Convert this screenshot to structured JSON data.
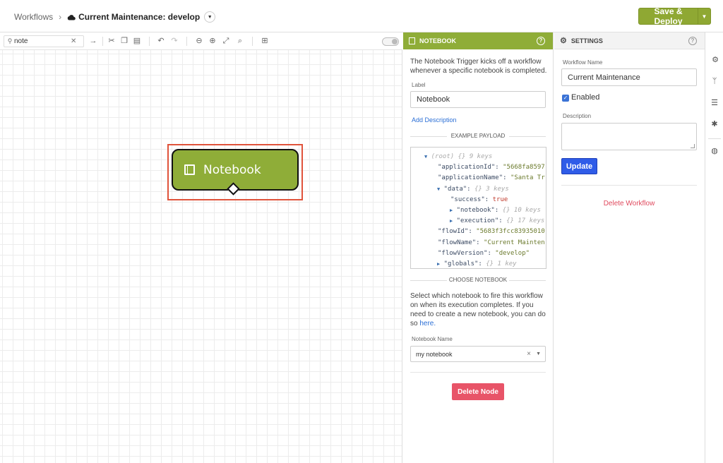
{
  "topbar": {
    "breadcrumb_root": "Workflows",
    "breadcrumb_sep": "›",
    "workflow_title": "Current Maintenance: develop",
    "save_label": "Save & Deploy"
  },
  "toolbar": {
    "search_value": "note",
    "search_placeholder": "Search"
  },
  "canvas": {
    "node_label": "Notebook"
  },
  "node_panel": {
    "title": "NOTEBOOK",
    "description": "The Notebook Trigger kicks off a workflow whenever a specific notebook is completed.",
    "label_caption": "Label",
    "label_value": "Notebook",
    "add_description": "Add Description",
    "example_payload_heading": "EXAMPLE PAYLOAD",
    "payload_lines": [
      {
        "indent": 0,
        "toggle": "▼",
        "key": "(root)",
        "meta": "{}  9 keys"
      },
      {
        "indent": 1,
        "key": "\"applicationId\":",
        "str": "\"5668fa8597"
      },
      {
        "indent": 1,
        "key": "\"applicationName\":",
        "str": "\"Santa Tr"
      },
      {
        "indent": 1,
        "toggle": "▼",
        "key": "\"data\":",
        "meta": "{}  3 keys"
      },
      {
        "indent": 2,
        "key": "\"success\":",
        "bool": "true"
      },
      {
        "indent": 2,
        "toggle": "▶",
        "key": "\"notebook\":",
        "meta": "{}  10 keys"
      },
      {
        "indent": 2,
        "toggle": "▶",
        "key": "\"execution\":",
        "meta": "{}  17 keys"
      },
      {
        "indent": 1,
        "key": "\"flowId\":",
        "str": "\"5683f3fcc83935010"
      },
      {
        "indent": 1,
        "key": "\"flowName\":",
        "str": "\"Current Mainten"
      },
      {
        "indent": 1,
        "key": "\"flowVersion\":",
        "str": "\"develop\""
      },
      {
        "indent": 1,
        "toggle": "▶",
        "key": "\"globals\":",
        "meta": "{}  1 key"
      }
    ],
    "choose_heading": "CHOOSE NOTEBOOK",
    "choose_description": "Select which notebook to fire this workflow on when its execution completes. If you need to create a new notebook, you can do so",
    "choose_link": "here.",
    "notebook_name_caption": "Notebook Name",
    "notebook_name_value": "my notebook",
    "delete_node_label": "Delete Node"
  },
  "settings_panel": {
    "title": "SETTINGS",
    "workflow_name_caption": "Workflow Name",
    "workflow_name_value": "Current Maintenance",
    "enabled_label": "Enabled",
    "description_caption": "Description",
    "update_label": "Update",
    "delete_workflow_label": "Delete Workflow"
  },
  "colors": {
    "accent_green": "#8fad38",
    "primary_blue": "#2f5ce8",
    "danger_red": "#e85468",
    "selection_red": "#e0533b"
  }
}
